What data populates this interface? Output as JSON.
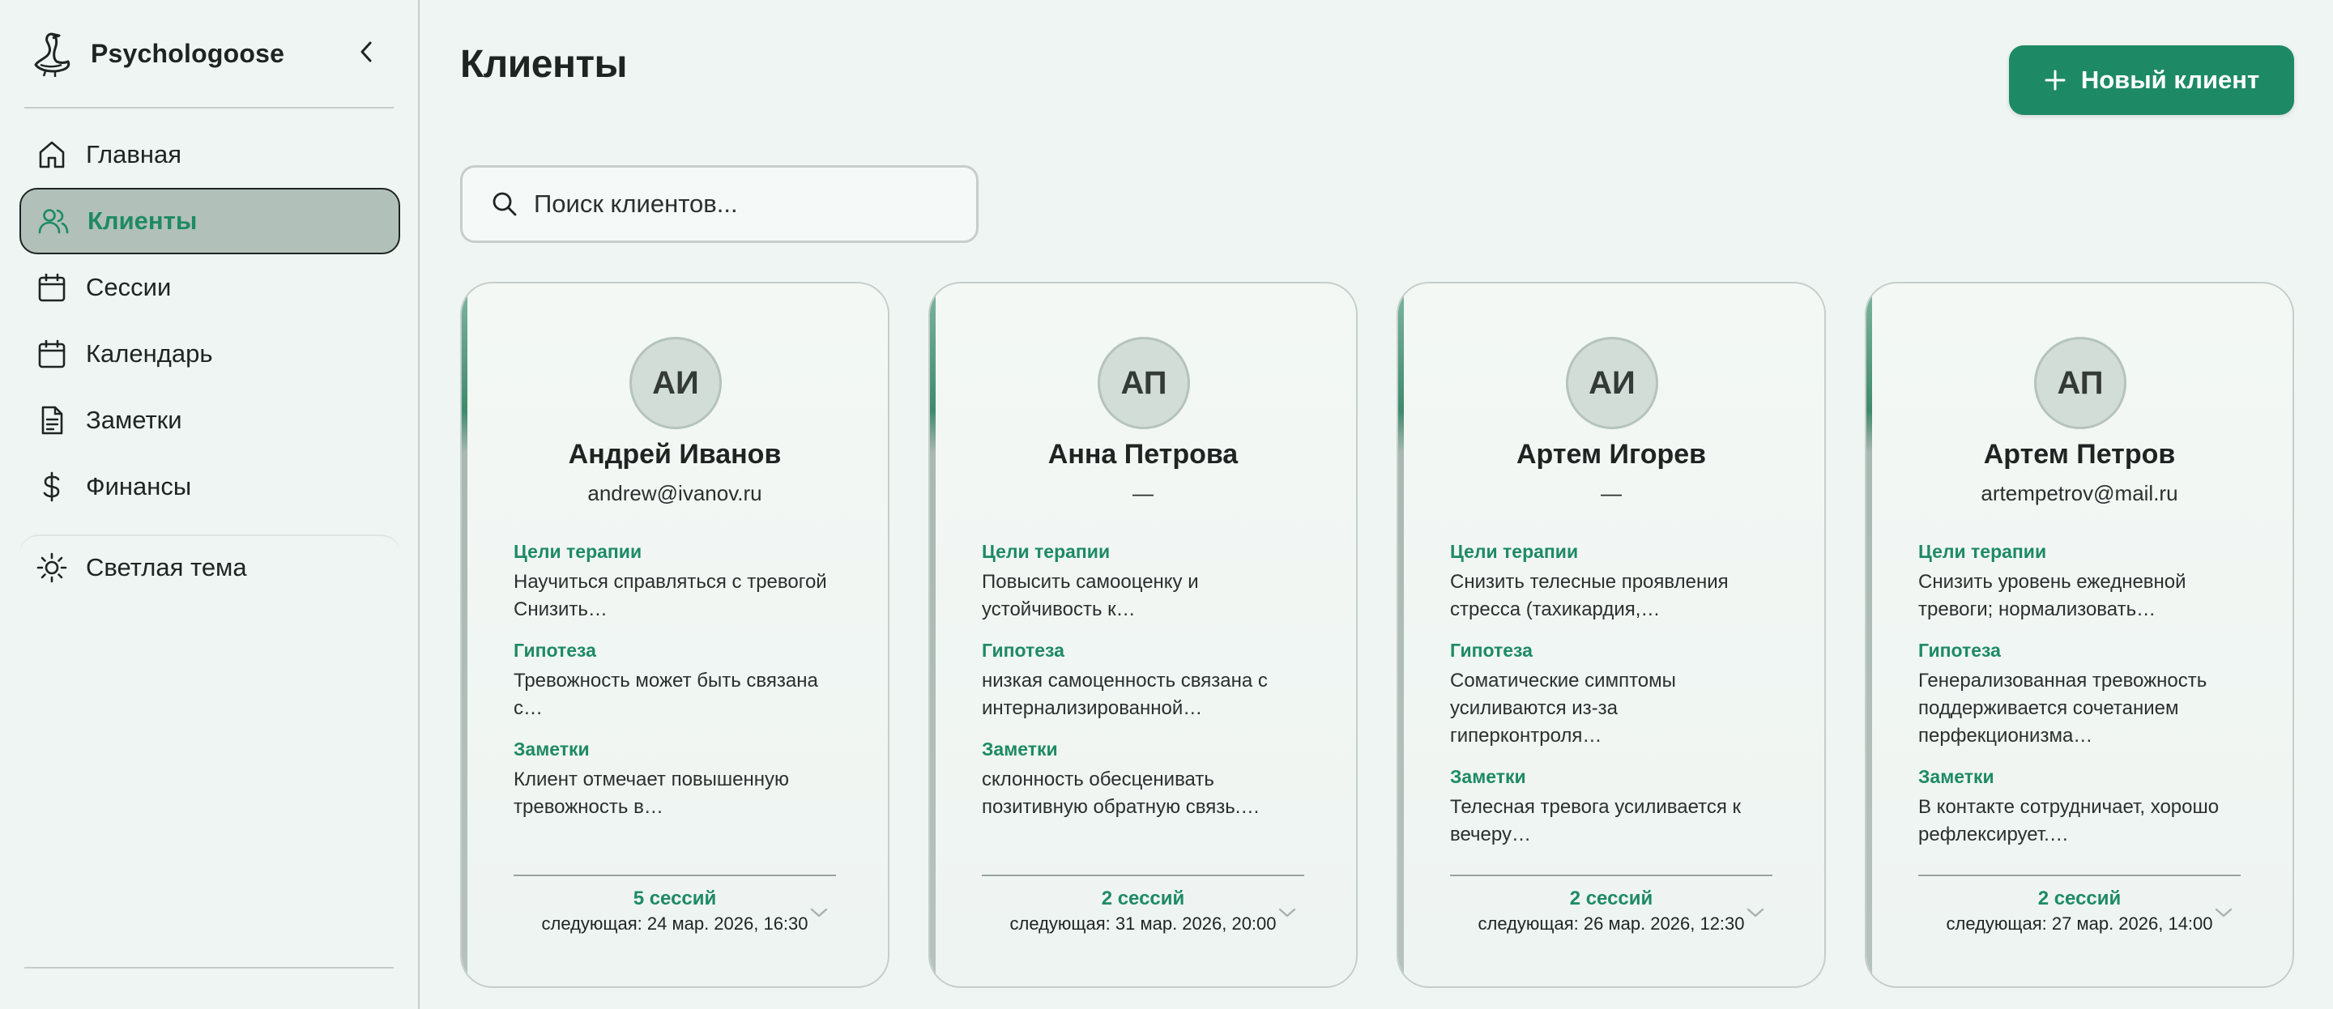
{
  "sidebar": {
    "brand": "Psychologoose",
    "nav": [
      {
        "label": "Главная",
        "icon": "home-icon"
      },
      {
        "label": "Клиенты",
        "icon": "users-icon",
        "active": true
      },
      {
        "label": "Сессии",
        "icon": "calendar-icon"
      },
      {
        "label": "Календарь",
        "icon": "calendar-icon"
      },
      {
        "label": "Заметки",
        "icon": "document-icon"
      },
      {
        "label": "Финансы",
        "icon": "dollar-icon"
      }
    ],
    "theme_label": "Светлая тема"
  },
  "header": {
    "title": "Клиенты",
    "new_client_label": "Новый клиент"
  },
  "search": {
    "placeholder": "Поиск клиентов..."
  },
  "section_labels": {
    "goals": "Цели терапии",
    "hypothesis": "Гипотеза",
    "notes": "Заметки"
  },
  "clients": [
    {
      "initials": "АИ",
      "name": "Андрей Иванов",
      "email": "andrew@ivanov.ru",
      "goals": [
        "Научиться справляться с тревогой",
        "Снизить…"
      ],
      "hypothesis": [
        "Тревожность может быть связана",
        "с…"
      ],
      "notes": [
        "Клиент отмечает повышенную",
        "тревожность в…"
      ],
      "sessions": "5 сессий",
      "next": "следующая: 24 мар. 2026, 16:30"
    },
    {
      "initials": "АП",
      "name": "Анна Петрова",
      "email": "—",
      "goals": [
        "Повысить самооценку и",
        "устойчивость к…"
      ],
      "hypothesis": [
        "низкая самоценность связана с",
        "интернализированной…"
      ],
      "notes": [
        "склонность обесценивать",
        "позитивную обратную связь.…"
      ],
      "sessions": "2 сессий",
      "next": "следующая: 31 мар. 2026, 20:00"
    },
    {
      "initials": "АИ",
      "name": "Артем Игорев",
      "email": "—",
      "goals": [
        "Снизить телесные проявления",
        "стресса (тахикардия,…"
      ],
      "hypothesis": [
        "Соматические симптомы",
        "усиливаются из-за",
        "гиперконтроля…"
      ],
      "notes": [
        "Телесная тревога усиливается к",
        "вечеру…"
      ],
      "sessions": "2 сессий",
      "next": "следующая: 26 мар. 2026, 12:30"
    },
    {
      "initials": "АП",
      "name": "Артем Петров",
      "email": "artempetrov@mail.ru",
      "goals": [
        "Снизить уровень ежедневной",
        "тревоги; нормализовать…"
      ],
      "hypothesis": [
        "Генерализованная тревожность",
        "поддерживается сочетанием",
        "перфекционизма…"
      ],
      "notes": [
        "В контакте сотрудничает, хорошо",
        "рефлексирует.…"
      ],
      "sessions": "2 сессий",
      "next": "следующая: 27 мар. 2026, 14:00"
    }
  ],
  "colors": {
    "accent": "#1e8a65",
    "background": "#eff5f2",
    "active_nav_bg": "#b2c0ba",
    "border": "#c5cecb"
  }
}
